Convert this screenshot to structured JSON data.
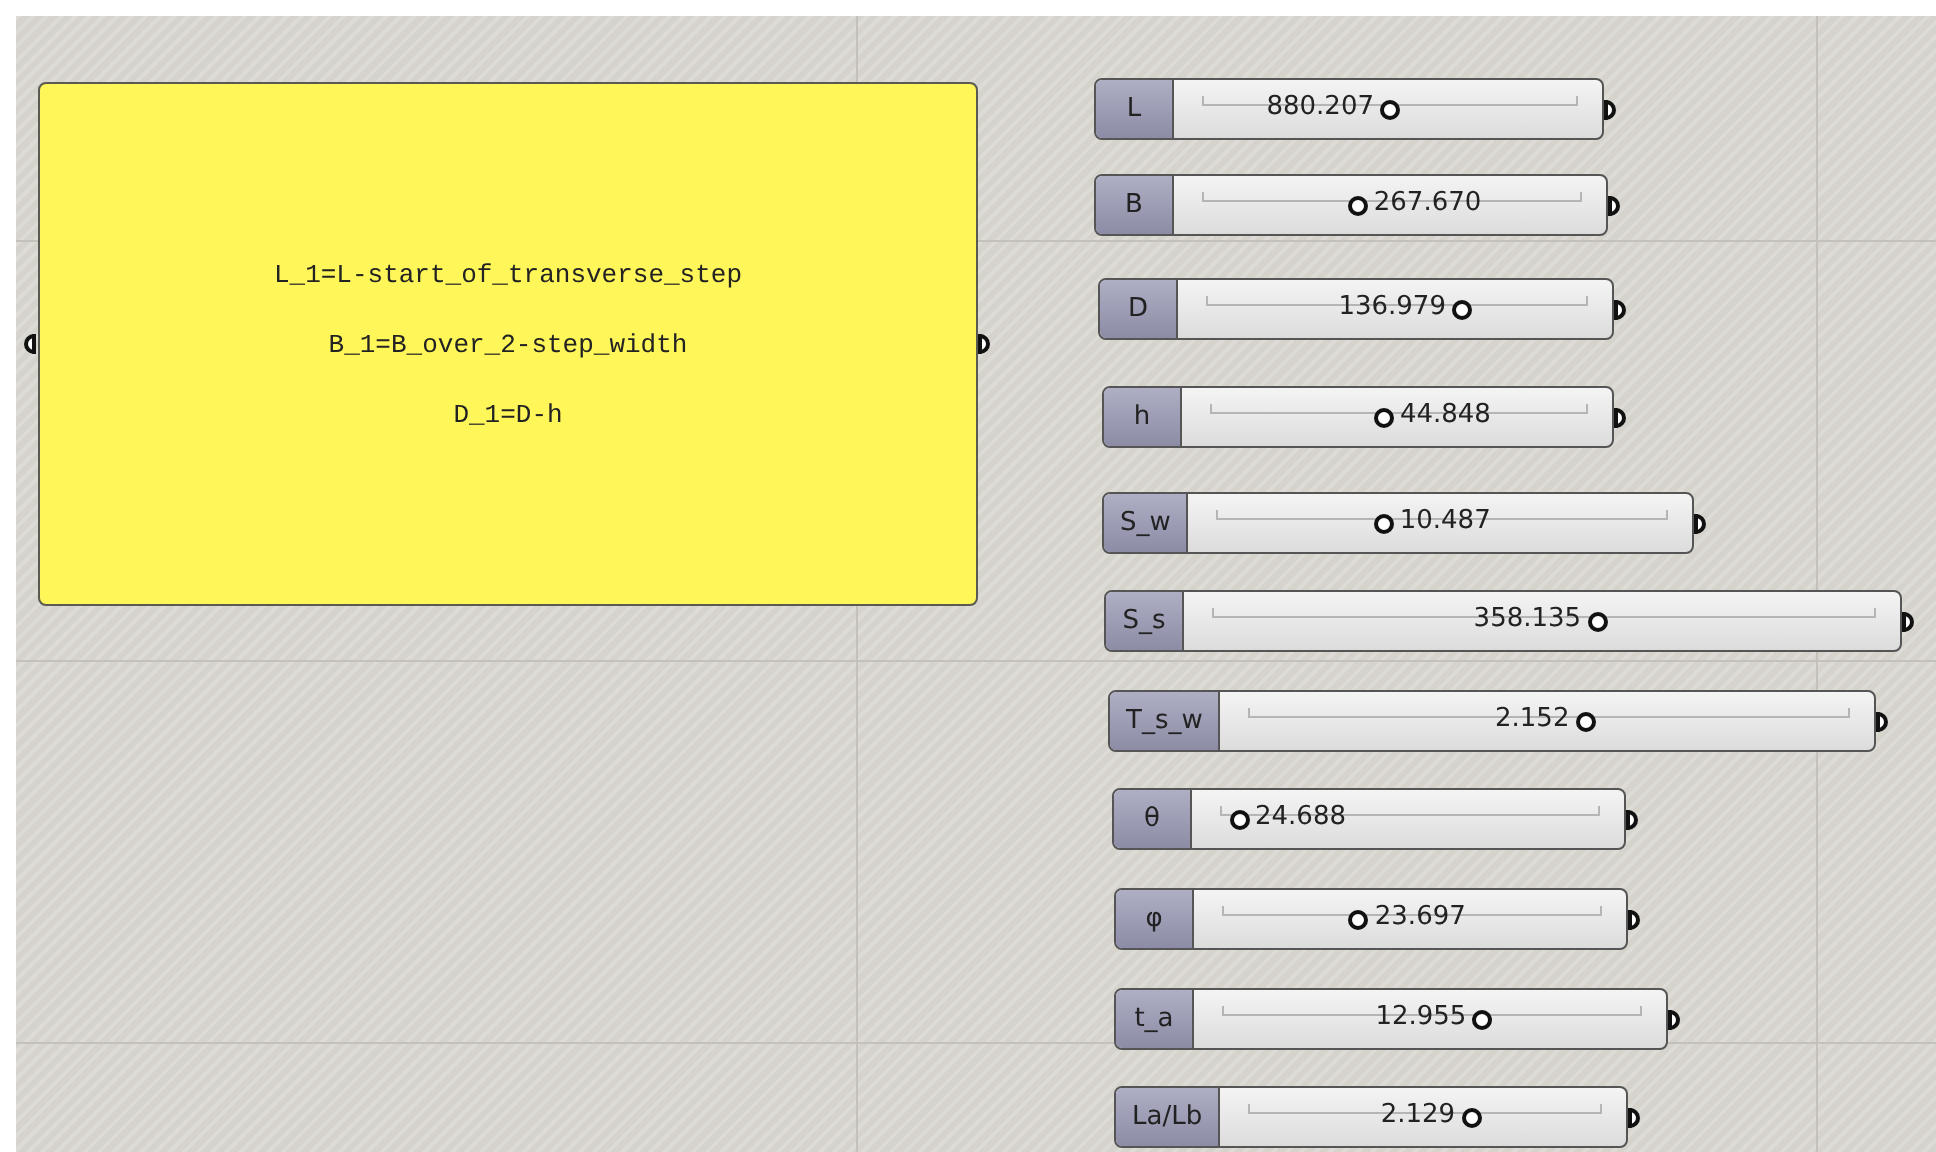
{
  "panel": {
    "lines": [
      "L_1=L-start_of_transverse_step",
      "B_1=B_over_2-step_width",
      "D_1=D-h"
    ]
  },
  "sliders": [
    {
      "name": "L",
      "value": "880.207",
      "level": 0.5
    },
    {
      "name": "B",
      "value": "267.670",
      "level": 0.41
    },
    {
      "name": "D",
      "value": "136.979",
      "level": 0.67
    },
    {
      "name": "h",
      "value": "44.848",
      "level": 0.46
    },
    {
      "name": "S_w",
      "value": "10.487",
      "level": 0.37
    },
    {
      "name": "S_s",
      "value": "358.135",
      "level": 0.58
    },
    {
      "name": "T_s_w",
      "value": "2.152",
      "level": 0.56
    },
    {
      "name": "θ",
      "value": "24.688",
      "level": 0.05
    },
    {
      "name": "φ",
      "value": "23.697",
      "level": 0.36
    },
    {
      "name": "t_a",
      "value": "12.955",
      "level": 0.62
    },
    {
      "name": "La/Lb",
      "value": "2.129",
      "level": 0.63
    }
  ]
}
